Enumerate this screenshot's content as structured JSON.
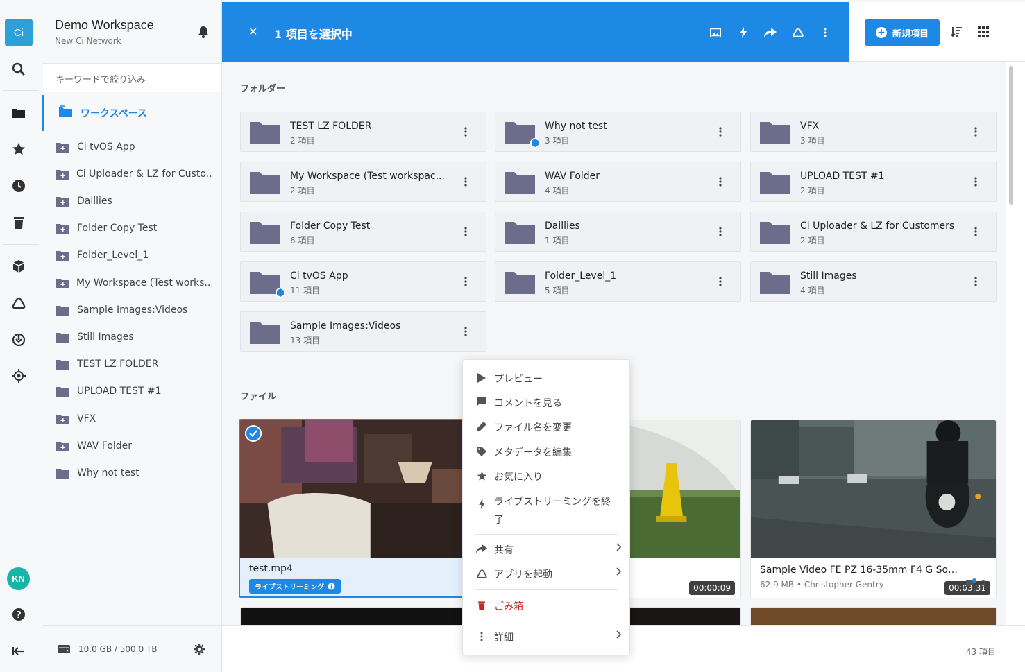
{
  "workspace": {
    "title": "Demo Workspace",
    "subtitle": "New Ci Network",
    "logo": "Ci"
  },
  "user": {
    "initials": "KN"
  },
  "filter": {
    "placeholder": "キーワードで絞り込み"
  },
  "sidebar": {
    "workspace_label": "ワークスペース",
    "items": [
      {
        "label": "Ci tvOS App",
        "icon": "folder-plus-icon"
      },
      {
        "label": "Ci Uploader & LZ for Custo...",
        "icon": "folder-plus-icon"
      },
      {
        "label": "Daillies",
        "icon": "folder-plus-icon"
      },
      {
        "label": "Folder Copy Test",
        "icon": "folder-plus-icon"
      },
      {
        "label": "Folder_Level_1",
        "icon": "folder-plus-icon"
      },
      {
        "label": "My Workspace (Test works...",
        "icon": "folder-plus-icon"
      },
      {
        "label": "Sample Images:Videos",
        "icon": "folder-icon"
      },
      {
        "label": "Still Images",
        "icon": "folder-icon"
      },
      {
        "label": "TEST LZ FOLDER",
        "icon": "folder-icon"
      },
      {
        "label": "UPLOAD TEST #1",
        "icon": "folder-icon"
      },
      {
        "label": "VFX",
        "icon": "folder-plus-icon"
      },
      {
        "label": "WAV Folder",
        "icon": "folder-plus-icon"
      },
      {
        "label": "Why not test",
        "icon": "folder-icon"
      }
    ],
    "storage": "10.0 GB / 500.0 TB"
  },
  "header": {
    "selection_title": "1 項目を選択中",
    "new_button": "新規項目"
  },
  "sections": {
    "folders": "フォルダー",
    "files": "ファイル"
  },
  "folders": [
    {
      "name": "TEST LZ FOLDER",
      "count": "2 項目",
      "shared": false
    },
    {
      "name": "Why not test",
      "count": "3 項目",
      "shared": true
    },
    {
      "name": "VFX",
      "count": "3 項目",
      "shared": false
    },
    {
      "name": "My Workspace (Test workspac...",
      "count": "2 項目",
      "shared": false
    },
    {
      "name": "WAV Folder",
      "count": "4 項目",
      "shared": false
    },
    {
      "name": "UPLOAD TEST #1",
      "count": "2 項目",
      "shared": false
    },
    {
      "name": "Folder Copy Test",
      "count": "6 項目",
      "shared": false
    },
    {
      "name": "Daillies",
      "count": "1 項目",
      "shared": false
    },
    {
      "name": "Ci Uploader & LZ for Customers",
      "count": "2 項目",
      "shared": false
    },
    {
      "name": "Ci tvOS App",
      "count": "11 項目",
      "shared": true
    },
    {
      "name": "Folder_Level_1",
      "count": "5 項目",
      "shared": false
    },
    {
      "name": "Still Images",
      "count": "4 項目",
      "shared": false
    },
    {
      "name": "Sample Images:Videos",
      "count": "13 項目",
      "shared": false
    }
  ],
  "files": [
    {
      "name": "test.mp4",
      "badge": "ライブストリーミング",
      "selected": true
    },
    {
      "name": "",
      "duration": "00:00:09"
    },
    {
      "name": "Sample Video FE PZ 16-35mm F4 G Sony ...",
      "meta": "62.9 MB • Christopher Gentry",
      "duration": "00:03:31",
      "comments": "3"
    }
  ],
  "context_menu": {
    "preview": "プレビュー",
    "comments": "コメントを見る",
    "rename": "ファイル名を変更",
    "edit_metadata": "メタデータを編集",
    "favorite": "お気に入り",
    "end_live_1": "ライブストリーミングを終",
    "end_live_2": "了",
    "share": "共有",
    "launch_app": "アプリを起動",
    "trash": "ごみ箱",
    "details": "詳細"
  },
  "footer": {
    "item_count": "43 項目"
  },
  "colors": {
    "accent": "#1e88e5",
    "folder": "#6b6d8a",
    "danger": "#c62828",
    "logo": "#2d9fd9",
    "avatar": "#16b5a7"
  }
}
